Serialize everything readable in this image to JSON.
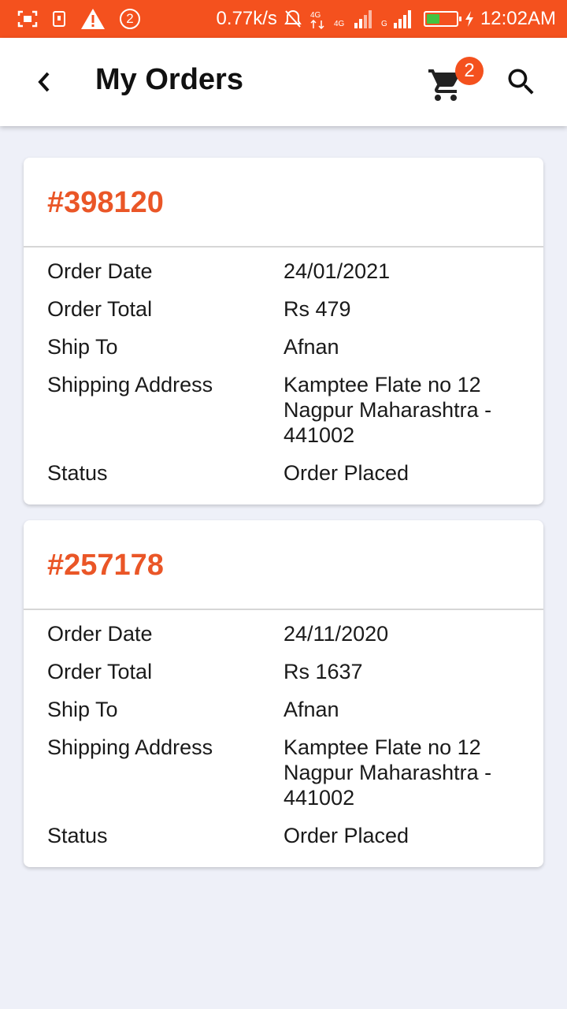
{
  "status_bar": {
    "net_speed": "0.77k/s",
    "time": "12:02AM",
    "notification_count": "2",
    "battery_level": 0.45,
    "icons": [
      "screenshot-icon",
      "sim-icon",
      "warning-icon",
      "notification-count-icon",
      "mute-icon",
      "data-arrows-icon",
      "signal-icon",
      "signal-icon",
      "battery-icon",
      "charging-icon"
    ]
  },
  "app_bar": {
    "title": "My Orders",
    "cart_count": "2",
    "back_icon": "chevron-left-icon",
    "cart_icon": "cart-icon",
    "search_icon": "search-icon"
  },
  "labels": {
    "order_date": "Order Date",
    "order_total": "Order Total",
    "ship_to": "Ship To",
    "shipping_address": "Shipping Address",
    "status": "Status"
  },
  "orders": [
    {
      "id": "#398120",
      "order_date": "24/01/2021",
      "order_total": "Rs 479",
      "ship_to": "Afnan",
      "address_line1": "Kamptee Flate no 12",
      "address_line2": "Nagpur Maharashtra -",
      "address_line3": "441002",
      "status": "Order Placed"
    },
    {
      "id": "#257178",
      "order_date": "24/11/2020",
      "order_total": "Rs 1637",
      "ship_to": "Afnan",
      "address_line1": "Kamptee Flate no 12",
      "address_line2": "Nagpur Maharashtra -",
      "address_line3": "441002",
      "status": "Order Placed"
    }
  ],
  "colors": {
    "accent": "#f4511e",
    "order_id": "#ea5627",
    "background": "#eef0f8"
  }
}
